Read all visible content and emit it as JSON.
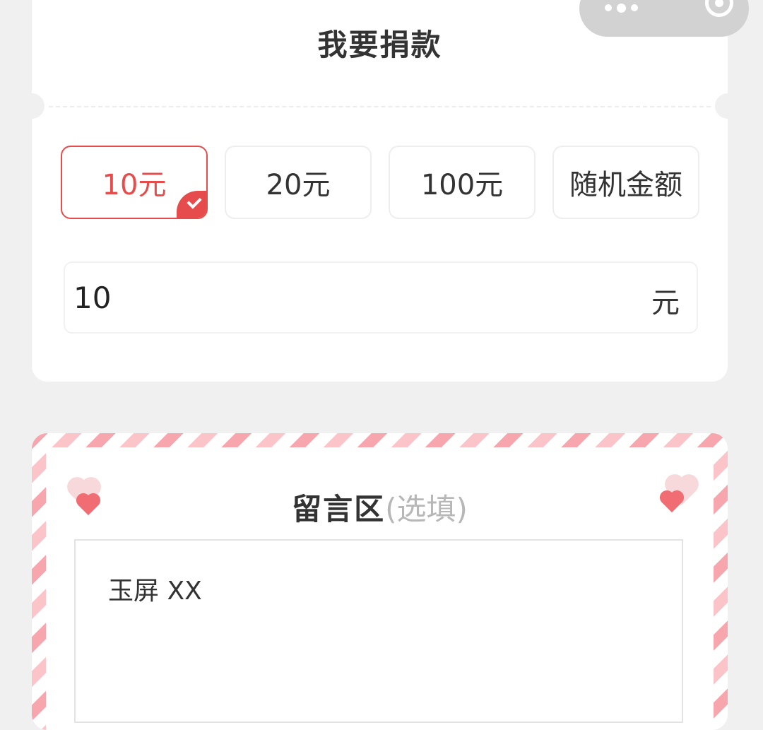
{
  "header": {
    "title": "我要捐款"
  },
  "donation": {
    "options": [
      {
        "label": "10元",
        "selected": true
      },
      {
        "label": "20元",
        "selected": false
      },
      {
        "label": "100元",
        "selected": false
      },
      {
        "label": "随机金额",
        "selected": false
      }
    ],
    "amount_value": "10",
    "amount_unit": "元"
  },
  "message": {
    "title": "留言区",
    "hint": "(选填)",
    "text": "玉屏 XX"
  },
  "colors": {
    "accent": "#e64c4c",
    "page_bg": "#f0f0f0",
    "stripe": "#f7a6ad"
  },
  "icons": [
    "more-dots-icon",
    "close-target-icon",
    "check-icon",
    "heart-icon"
  ]
}
